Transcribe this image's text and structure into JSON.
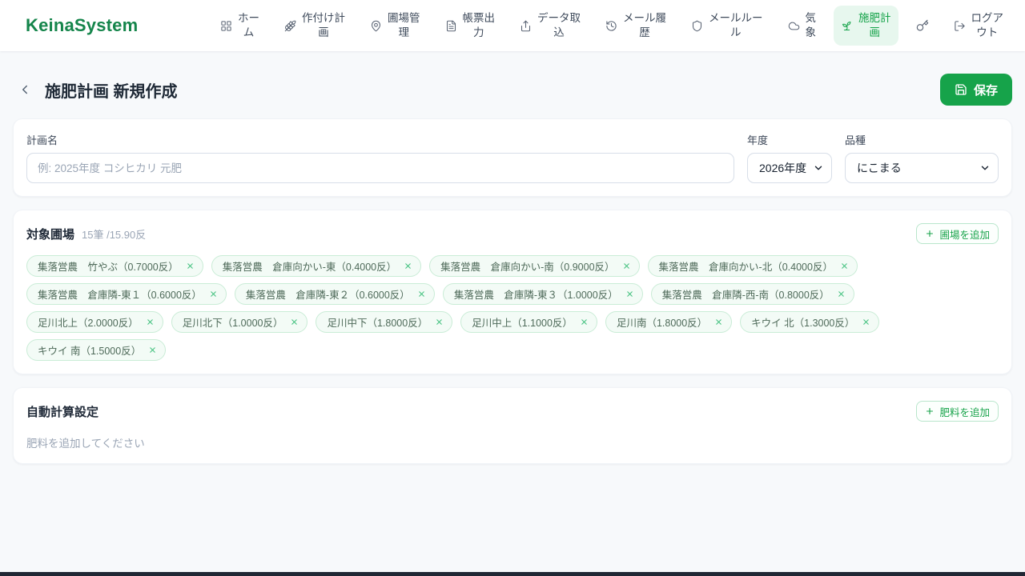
{
  "colors": {
    "accent": "#16a34a",
    "accent_light_bg": "#e7f7ee",
    "logo": "#15854b"
  },
  "app": {
    "title": "KeinaSystem"
  },
  "nav": {
    "items": [
      {
        "label": "ホー\nム",
        "icon": "grid"
      },
      {
        "label": "作付け計\n画",
        "icon": "wheat"
      },
      {
        "label": "圃場管\n理",
        "icon": "map-pin"
      },
      {
        "label": "帳票出\n力",
        "icon": "file-text"
      },
      {
        "label": "データ取\n込",
        "icon": "upload"
      },
      {
        "label": "メール履\n歴",
        "icon": "history"
      },
      {
        "label": "メールルー\nル",
        "icon": "shield"
      },
      {
        "label": "気\n象",
        "icon": "cloud"
      },
      {
        "label": "施肥計\n画",
        "icon": "sprout",
        "active": true
      },
      {
        "label": "",
        "icon": "key"
      },
      {
        "label": "ログア\nウト",
        "icon": "logout"
      }
    ]
  },
  "page": {
    "title": "施肥計画 新規作成",
    "save_label": "保存"
  },
  "form": {
    "plan_name": {
      "label": "計画名",
      "placeholder": "例: 2025年度 コシヒカリ 元肥",
      "value": ""
    },
    "year": {
      "label": "年度",
      "value": "2026年度"
    },
    "variety": {
      "label": "品種",
      "value": "にこまる"
    }
  },
  "fields_section": {
    "title": "対象圃場",
    "count": "15筆 /15.90反",
    "add_label": "圃場を追加",
    "chips": [
      "集落営農　竹やぶ（0.7000反）",
      "集落営農　倉庫向かい-東（0.4000反）",
      "集落営農　倉庫向かい-南（0.9000反）",
      "集落営農　倉庫向かい-北（0.4000反）",
      "集落営農　倉庫隣-東１（0.6000反）",
      "集落営農　倉庫隣-東２（0.6000反）",
      "集落営農　倉庫隣-東３（1.0000反）",
      "集落営農　倉庫隣-西-南（0.8000反）",
      "足川北上（2.0000反）",
      "足川北下（1.0000反）",
      "足川中下（1.8000反）",
      "足川中上（1.1000反）",
      "足川南（1.8000反）",
      "キウイ 北（1.3000反）",
      "キウイ 南（1.5000反）"
    ]
  },
  "fertilizer_section": {
    "title": "自動計算設定",
    "add_label": "肥料を追加",
    "empty_text": "肥料を追加してください"
  }
}
